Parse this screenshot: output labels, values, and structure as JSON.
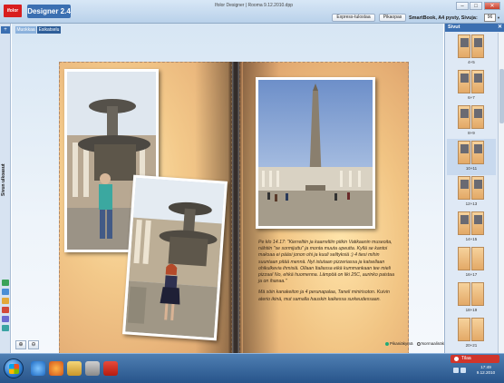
{
  "window": {
    "title": "Ifolor Designer | Rooma 9.12.2010.dpp",
    "app_logo": "ifolor",
    "app_name": "Designer 2.4"
  },
  "toolbar": {
    "express_label": "Express-tulostaa",
    "small_label": "Pikaopas",
    "min_label": "–",
    "max_label": "□",
    "close_label": "✕"
  },
  "info": {
    "product_text": "SmartBook, A4 pysty, Sivuja:",
    "zoom_value": "96"
  },
  "left_side": {
    "collapse_label": "+",
    "vertical_label": "Sivun ulkoasut"
  },
  "tabs": [
    {
      "label": "Muokkaa"
    },
    {
      "label": "Esikatselu"
    }
  ],
  "story": {
    "paragraph1": "Pe klo 14.17: \"Kierreltiin ja kaarreltiin pitkin Vatikaanin museoita, nähtiin \"se sormijuttu\" ja monta muuta upeutta. Kyllä se kantoi maksaa ei pääsi jonon ohi ja kuuli selityksiä :) 4 tiesi mihin suuntaan pitää mennä. Nyt istutaan pizzeriassa ja katsellaan ohikulkevia ihmisiä. Ollaan Italiassa eikä kummankaan tee mieli pizzaa! No, ehkä huomenna. Lämpöä on liki 25C, aurinko paistaa ja on ihanaa.\"",
    "paragraph2": "Mä söin kanakeiton ja 4 perunapalaa, Taneli minirisoton. Kuivin aterio ikinä, mut samalla hauskin kaikessa surkeudessaan."
  },
  "view_options": {
    "option1": "Pikaniäkymä",
    "option2": "Normaalinäkymä"
  },
  "right_panel": {
    "title": "Sivut",
    "close": "✕",
    "thumbnails": [
      {
        "label": "4+5"
      },
      {
        "label": "6+7"
      },
      {
        "label": "8+9"
      },
      {
        "label": "10+11"
      },
      {
        "label": "12+13"
      },
      {
        "label": "14+15"
      },
      {
        "label": "16+17"
      },
      {
        "label": "18+19"
      },
      {
        "label": "20+21"
      }
    ]
  },
  "taskbar": {
    "tray_popup": "Tilaa",
    "time": "17:49",
    "date": "9.12.2010"
  },
  "colors": {
    "accent": "#3b6fb1",
    "brand_red": "#d81e1e",
    "taskbar": "#27548a"
  }
}
